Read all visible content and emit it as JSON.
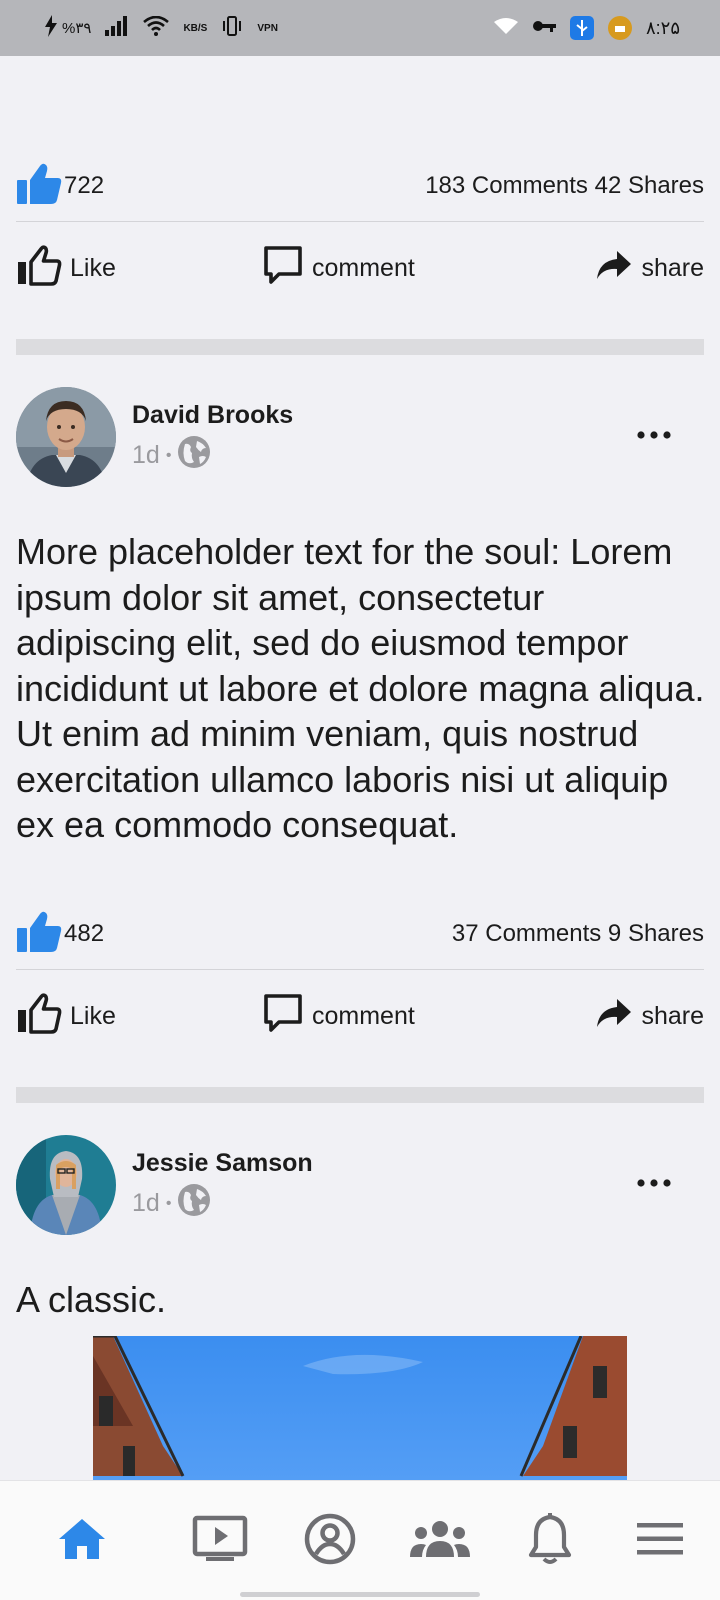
{
  "status_bar": {
    "battery": "%۳۹",
    "speed_unit": "KB/S",
    "vpn_label": "VPN",
    "time": "۸:۲۵",
    "icons": [
      "charging-bolt-icon",
      "signal-icon",
      "wifi-icon",
      "vibrate-icon",
      "vpn-icon",
      "wifi-hotspot-icon",
      "key-icon",
      "usb-icon",
      "download-icon"
    ]
  },
  "posts": [
    {
      "likes": "722",
      "comments_shares": "183 Comments 42 Shares"
    },
    {
      "author": "David Brooks",
      "time": "1d",
      "dot": "•",
      "text": "More placeholder text for the soul: Lorem ipsum dolor sit amet, consectetur adipiscing elit, sed do eiusmod tempor incididunt ut labore et dolore magna aliqua. Ut enim ad minim veniam, quis nostrud exercitation ullamco laboris nisi ut aliquip ex ea commodo consequat.",
      "likes": "482",
      "comments_shares": "37 Comments 9 Shares"
    },
    {
      "author": "Jessie Samson",
      "time": "1d",
      "dot": "•",
      "text": "A classic."
    }
  ],
  "actions": {
    "like": "Like",
    "comment": "comment",
    "share": "share"
  },
  "bottom_nav": {
    "items": [
      "home-icon",
      "video-icon",
      "profile-icon",
      "groups-icon",
      "notifications-icon",
      "menu-icon"
    ],
    "active": "home-icon"
  },
  "colors": {
    "accent": "#2d88e8",
    "background": "#f1f1f5",
    "status_bar": "#b5b6ba",
    "muted_text": "#9a9a9e",
    "separator": "#dcdcdf"
  }
}
